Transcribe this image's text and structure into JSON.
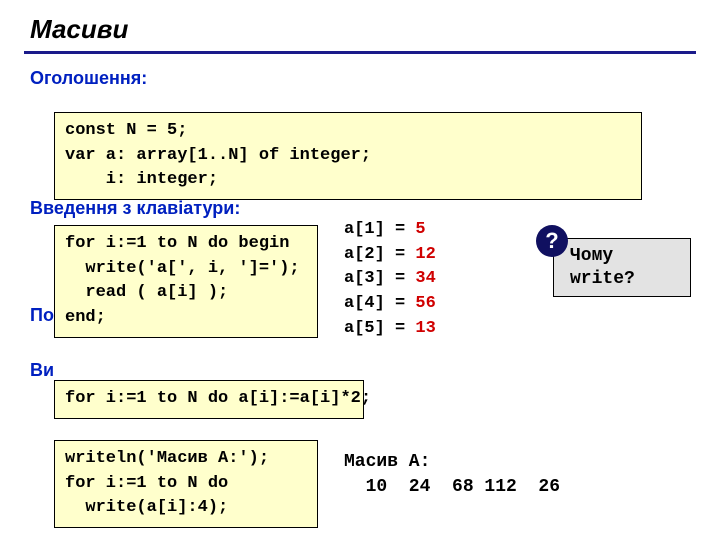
{
  "title": "Масиви",
  "sections": {
    "declaration": "Оголошення:",
    "input": "Введення з клавіатури:",
    "poelem_prefix": "По",
    "output_prefix": "Ви"
  },
  "code": {
    "decl_l1": "const N = 5;",
    "decl_l2": "var a: array[1..N] of integer;",
    "decl_l3": "    i: integer;",
    "read_l1": "for i:=1 to N do begin",
    "read_l2": "  write('a[', i, ']=');",
    "read_l3": "  read ( a[i] );",
    "read_l4": "end;",
    "double": "for i:=1 to N do a[i]:=a[i]*2;",
    "print_l1": "writeln('Масив A:');",
    "print_l2": "for i:=1 to N do ",
    "print_l3": "  write(a[i]:4);"
  },
  "avalues": [
    {
      "k": "a[1] = ",
      "v": "5"
    },
    {
      "k": "a[2] = ",
      "v": "12"
    },
    {
      "k": "a[3] = ",
      "v": "34"
    },
    {
      "k": "a[4] = ",
      "v": "56"
    },
    {
      "k": "a[5] = ",
      "v": "13"
    }
  ],
  "callout": {
    "mark": "?",
    "l1": "Чому",
    "l2": " write?"
  },
  "output": {
    "l1": "Масив A:",
    "l2": "  10  24  68 112  26"
  }
}
